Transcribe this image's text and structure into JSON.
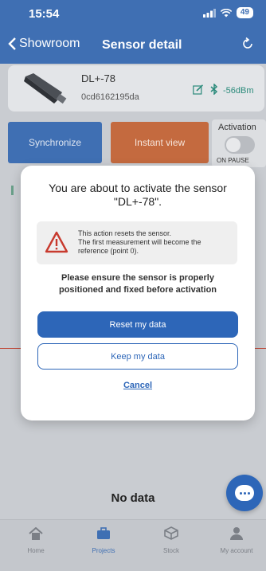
{
  "status_bar": {
    "time": "15:54",
    "signal_icon": "signal-bars-icon",
    "wifi_icon": "wifi-icon",
    "battery": "49"
  },
  "nav": {
    "back_label": "Showroom",
    "title": "Sensor detail",
    "refresh_icon": "refresh-icon"
  },
  "sensor": {
    "name": "DL+-78",
    "id": "0cd6162195da",
    "signal": "-56dBm"
  },
  "actions": {
    "synchronize_label": "Synchronize",
    "instant_view_label": "Instant view",
    "activation_title": "Activation",
    "activation_status": "ON PAUSE"
  },
  "main": {
    "no_data": "No data"
  },
  "modal": {
    "title_line1": "You are about to activate the sensor",
    "title_line2": "\"DL+-78\".",
    "warning_line1": "This action resets the sensor.",
    "warning_line2": "The first measurement will become the",
    "warning_line3": "reference (point 0).",
    "note_line1": "Please ensure the sensor is properly",
    "note_line2": "positioned and fixed before activation",
    "reset_label": "Reset my data",
    "keep_label": "Keep my data",
    "cancel_label": "Cancel"
  },
  "tabbar": {
    "tabs": [
      {
        "label": "Home",
        "icon": "home-icon"
      },
      {
        "label": "Projects",
        "icon": "briefcase-icon",
        "active": true
      },
      {
        "label": "Stock",
        "icon": "box-icon"
      },
      {
        "label": "My account",
        "icon": "user-icon"
      }
    ]
  },
  "colors": {
    "primary": "#2d66b8",
    "header": "#3f6fb3",
    "instant_view": "#c46a3f",
    "sensor_accent": "#2a8a7a"
  }
}
